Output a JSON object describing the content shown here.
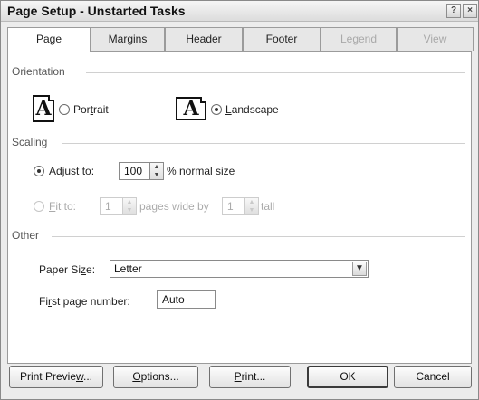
{
  "window": {
    "title": "Page Setup - Unstarted Tasks",
    "help_glyph": "?",
    "close_glyph": "×"
  },
  "tabs": [
    {
      "label": "Page",
      "state": "active"
    },
    {
      "label": "Margins",
      "state": "normal"
    },
    {
      "label": "Header",
      "state": "normal"
    },
    {
      "label": "Footer",
      "state": "normal"
    },
    {
      "label": "Legend",
      "state": "disabled"
    },
    {
      "label": "View",
      "state": "disabled"
    }
  ],
  "orientation": {
    "group_label": "Orientation",
    "glyph_letter": "A",
    "portrait": {
      "pre": "Por",
      "ul": "t",
      "post": "rait",
      "selected": false
    },
    "landscape": {
      "pre": "",
      "ul": "L",
      "post": "andscape",
      "selected": true
    }
  },
  "scaling": {
    "group_label": "Scaling",
    "adjust": {
      "pre": "",
      "ul": "A",
      "post": "djust to:",
      "selected": true,
      "value": "100",
      "suffix": "% normal size"
    },
    "fit": {
      "pre": "",
      "ul": "F",
      "post": "it to:",
      "selected": false,
      "wide_value": "1",
      "wide_label": "pages wide by",
      "tall_value": "1",
      "tall_label": "tall"
    }
  },
  "other": {
    "group_label": "Other",
    "paper_size": {
      "pre": "Paper Si",
      "ul": "z",
      "post": "e:",
      "value": "Letter"
    },
    "first_page": {
      "pre": "Fi",
      "ul": "r",
      "post": "st page number:",
      "value": "Auto"
    }
  },
  "buttons": {
    "print_preview": {
      "pre": "Print Previe",
      "ul": "w",
      "post": "..."
    },
    "options": {
      "pre": "",
      "ul": "O",
      "post": "ptions..."
    },
    "print": {
      "pre": "",
      "ul": "P",
      "post": "rint..."
    },
    "ok": {
      "pre": "OK",
      "ul": "",
      "post": ""
    },
    "cancel": {
      "pre": "Cancel",
      "ul": "",
      "post": ""
    }
  },
  "colors": {
    "dialog_bg": "#ececec",
    "panel_bg": "#ffffff",
    "disabled_text": "#aaaaaa"
  }
}
